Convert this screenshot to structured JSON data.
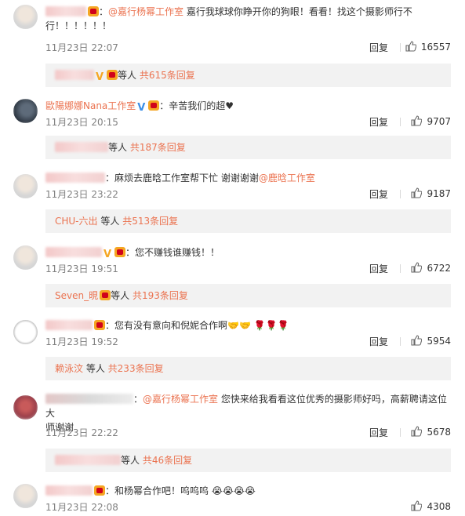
{
  "comments": [
    {
      "text_prefix": "：",
      "mention": "@嘉行杨幂工作室",
      "text": " 嘉行我球球你睁开你的狗眼！看看！找这个摄影师行不",
      "text2": "行！！！！！！",
      "time": "11月23日 22:07",
      "reply_label": "回复",
      "likes": "16557",
      "sub_suffix": "等人",
      "sub_count": "共615条回复"
    },
    {
      "username": "歐陽娜娜Nana工作室",
      "text": "：辛苦我们的超♥",
      "time": "11月23日 20:15",
      "reply_label": "回复",
      "likes": "9707",
      "sub_suffix": "等人",
      "sub_count": "共187条回复"
    },
    {
      "text": "：麻烦去鹿晗工作室帮下忙 谢谢谢谢",
      "mention": "@鹿晗工作室",
      "time": "11月23日 23:22",
      "reply_label": "回复",
      "likes": "9187",
      "sub_user": "CHU-六出",
      "sub_suffix": " 等人",
      "sub_count": "共513条回复"
    },
    {
      "text": "：您不赚钱谁赚钱！！",
      "time": "11月23日 19:51",
      "reply_label": "回复",
      "likes": "6722",
      "sub_user": "Seven_晛",
      "sub_suffix": "等人",
      "sub_count": "共193条回复"
    },
    {
      "text": "：您有没有意向和倪妮合作啊",
      "time": "11月23日 19:52",
      "reply_label": "回复",
      "likes": "5954",
      "sub_user": "赖泳汶",
      "sub_suffix": " 等人",
      "sub_count": "共233条回复"
    },
    {
      "text_prefix": "：",
      "mention": "@嘉行杨幂工作室",
      "text": " 您快来给我看看这位优秀的摄影师好吗，高薪聘请这位大",
      "text2": "师谢谢",
      "time": "11月23日 22:22",
      "reply_label": "回复",
      "likes": "5678",
      "sub_suffix": "等人",
      "sub_count": "共46条回复"
    },
    {
      "text": "：和杨幂合作吧！呜呜呜",
      "time": "11月23日 22:08",
      "reply_label": "回复",
      "likes": "4308"
    }
  ]
}
